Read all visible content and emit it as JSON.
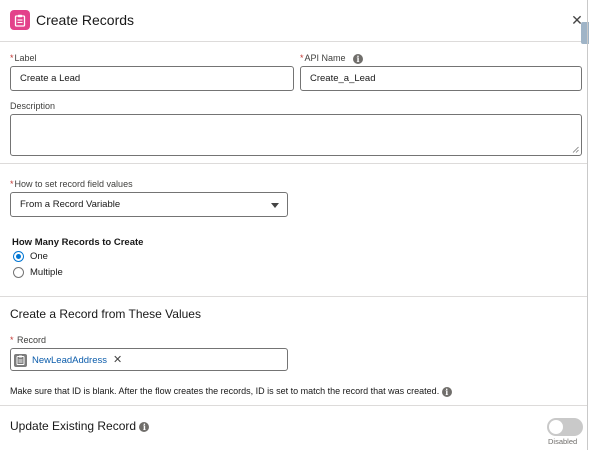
{
  "header": {
    "title": "Create Records"
  },
  "label_field": {
    "label": "Label",
    "value": "Create a Lead"
  },
  "api_name_field": {
    "label": "API Name",
    "value": "Create_a_Lead"
  },
  "description_field": {
    "label": "Description",
    "value": ""
  },
  "record_values": {
    "label": "How to set record field values",
    "selected": "From a Record Variable"
  },
  "how_many": {
    "label": "How Many Records to Create",
    "options": [
      "One",
      "Multiple"
    ],
    "selected": "One"
  },
  "section": {
    "title": "Create a Record from These Values"
  },
  "record_field": {
    "label": "Record",
    "value": "NewLeadAddress"
  },
  "help_text": "Make sure that ID is blank. After the flow creates the records, ID is set to match the record that was created.",
  "update_existing": {
    "label": "Update Existing Record",
    "status": "Disabled",
    "enabled": false
  },
  "colors": {
    "header_icon": "#e3428b",
    "accent": "#0176d3",
    "required": "#c23934",
    "pill_text": "#0b5cab"
  },
  "icons": {
    "header": "create-record-icon",
    "close": "close-icon",
    "info": "info-icon",
    "record": "record-variable-icon",
    "remove": "remove-icon"
  }
}
